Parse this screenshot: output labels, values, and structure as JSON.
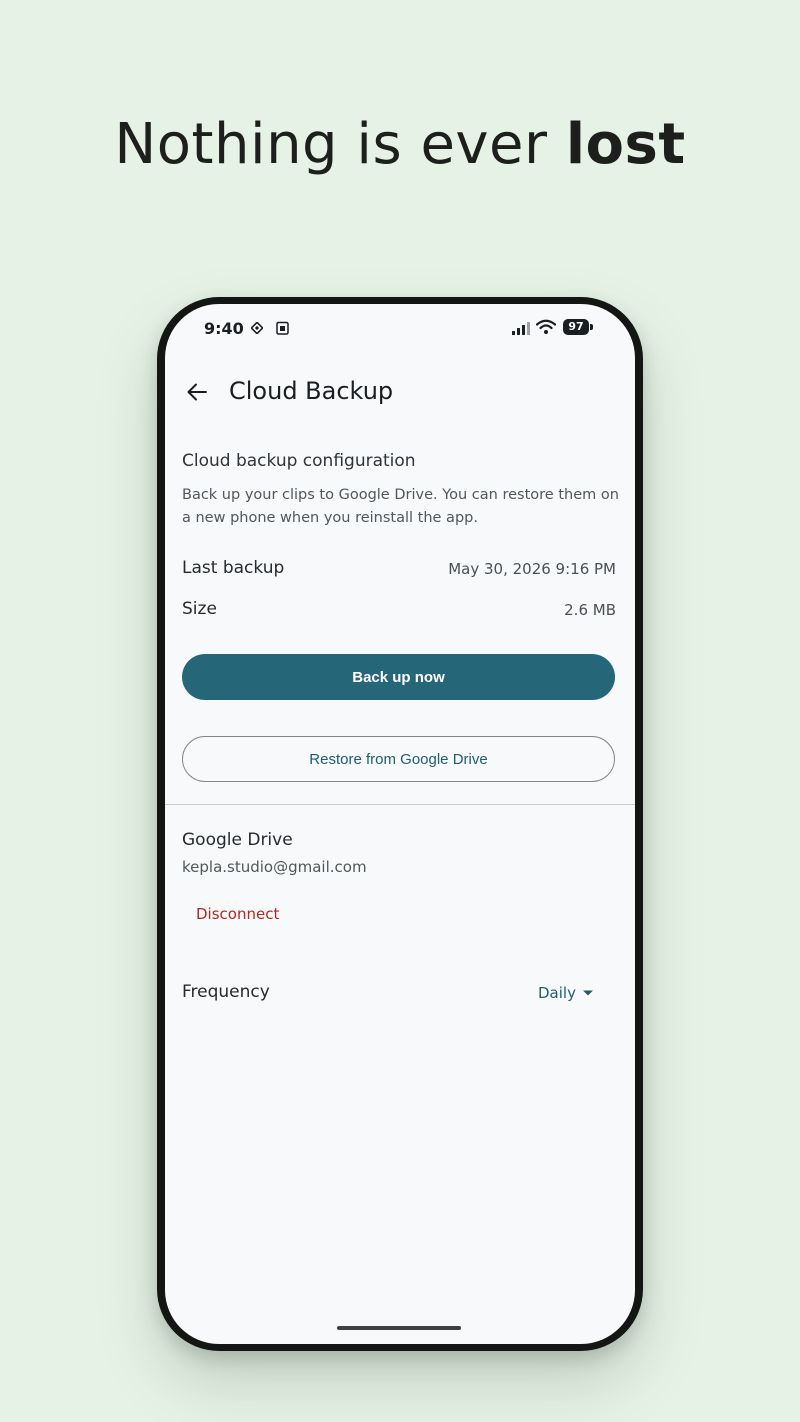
{
  "headline": {
    "light": "Nothing is ever ",
    "bold": "lost"
  },
  "status_bar": {
    "time": "9:40",
    "battery": "97",
    "icons": [
      "sim-icon",
      "calendar-icon",
      "signal-icon",
      "wifi-icon",
      "battery-icon"
    ]
  },
  "app_bar": {
    "back_icon": "arrow-back-icon",
    "title": "Cloud Backup"
  },
  "backup": {
    "section_title": "Cloud backup configuration",
    "description": "Back up your clips to Google Drive. You can restore them on a new phone when you reinstall the app.",
    "last_backup_label": "Last backup",
    "last_backup_value": "May 30, 2026 9:16 PM",
    "size_label": "Size",
    "size_value": "2.6 MB",
    "backup_now_label": "Back up now",
    "restore_label": "Restore from Google Drive"
  },
  "drive": {
    "title": "Google Drive",
    "email": "kepla.studio@gmail.com",
    "disconnect_label": "Disconnect"
  },
  "frequency": {
    "label": "Frequency",
    "selected": "Daily"
  },
  "colors": {
    "background": "#e6f2e6",
    "primary": "#256679",
    "danger": "#b3261e"
  }
}
